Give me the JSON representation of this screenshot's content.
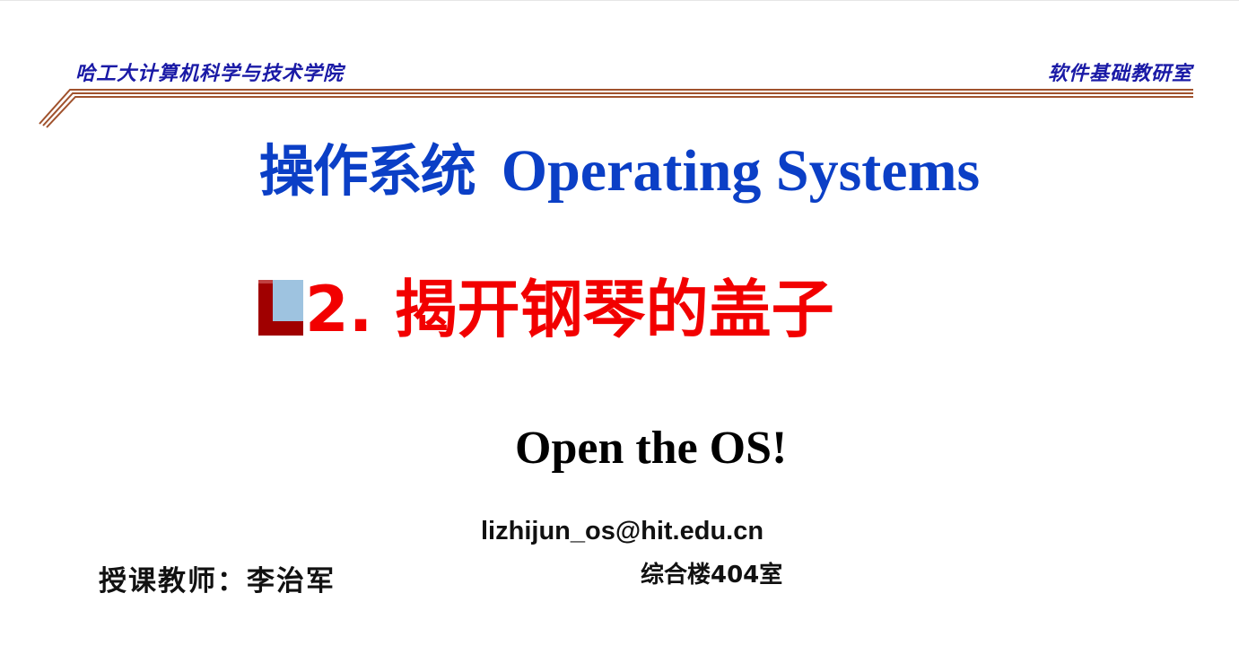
{
  "header": {
    "school": "哈工大计算机科学与技术学院",
    "department": "软件基础教研室"
  },
  "title": {
    "chinese": "操作系统",
    "english": "Operating Systems"
  },
  "lecture": {
    "label": "2. 揭开钢琴的盖子"
  },
  "subtitle": "Open the OS!",
  "contact": {
    "email": "lizhijun_os@hit.edu.cn",
    "office": "综合楼404室"
  },
  "teacher": {
    "label": "授课教师：李治军"
  },
  "colors": {
    "header_text": "#1a1aa6",
    "title": "#0b3fc6",
    "lecture": "#f20000",
    "rule": "#a0522d",
    "logo_dark": "#a00000",
    "logo_light": "#9ec3e0"
  }
}
